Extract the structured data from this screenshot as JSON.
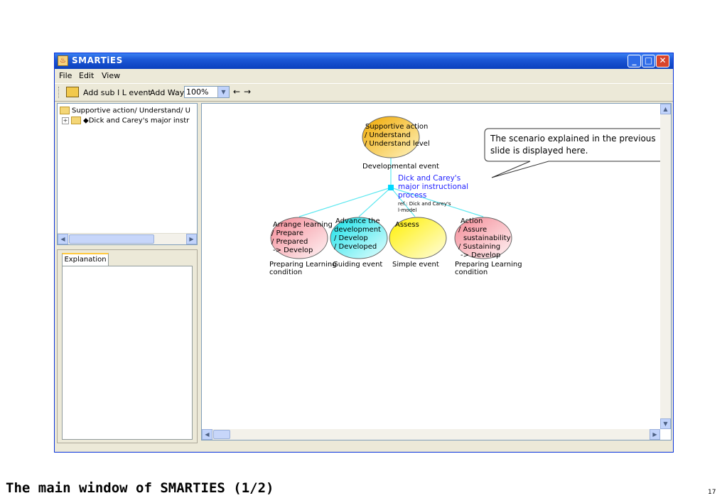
{
  "window": {
    "title": "SMARTiES",
    "min_label": "_",
    "max_label": "□",
    "close_label": "✕"
  },
  "menu": [
    "File",
    "Edit",
    "View"
  ],
  "toolbar": {
    "add_sub_label": "Add sub I L event",
    "add_way_label": "Add Way",
    "zoom": "100%",
    "back": "←",
    "forward": "→"
  },
  "tree": {
    "root": "Supportive action/ Understand/ U",
    "child": "◆Dick and Carey's major instr",
    "expander": "+"
  },
  "explanation": {
    "tab_label": "Explanation"
  },
  "canvas": {
    "top_node": {
      "lines": [
        "Supportive action",
        "/ Understand",
        "/ Understand level"
      ],
      "caption": "Developmental event"
    },
    "hub": {
      "lines": [
        "Dick and Carey's",
        "major instructional",
        "process"
      ],
      "ref_lines": [
        "ref.: Dick and Carey's",
        "l-model"
      ]
    },
    "children": [
      {
        "lines": [
          "Arrange learning",
          "/ Prepare",
          "/ Prepared",
          "-> Develop"
        ],
        "caption": [
          "Preparing Learning",
          "condition"
        ],
        "color": "#f7c1c6"
      },
      {
        "lines": [
          "Advance the",
          "development",
          "/ Develop",
          "/ Developed"
        ],
        "caption": [
          "Guiding event"
        ],
        "color": "#2fe6ec"
      },
      {
        "lines": [
          "Assess"
        ],
        "caption": [
          "Simple event"
        ],
        "color": "#fff200"
      },
      {
        "lines": [
          "Action",
          "/ Assure",
          "sustainability",
          "/ Sustaining",
          "-> Develop"
        ],
        "caption": [
          "Preparing Learning",
          "condition"
        ],
        "color": "#f7c1c6"
      }
    ],
    "callout": [
      "The scenario explained in the previous",
      "slide is displayed here."
    ],
    "colors": {
      "link": "#5fe8f0",
      "hub_text": "#2222ff",
      "top_fill": "#f2b01a"
    }
  },
  "slide": {
    "caption": "The main window of SMARTIES (1/2)",
    "page_number": "17"
  }
}
